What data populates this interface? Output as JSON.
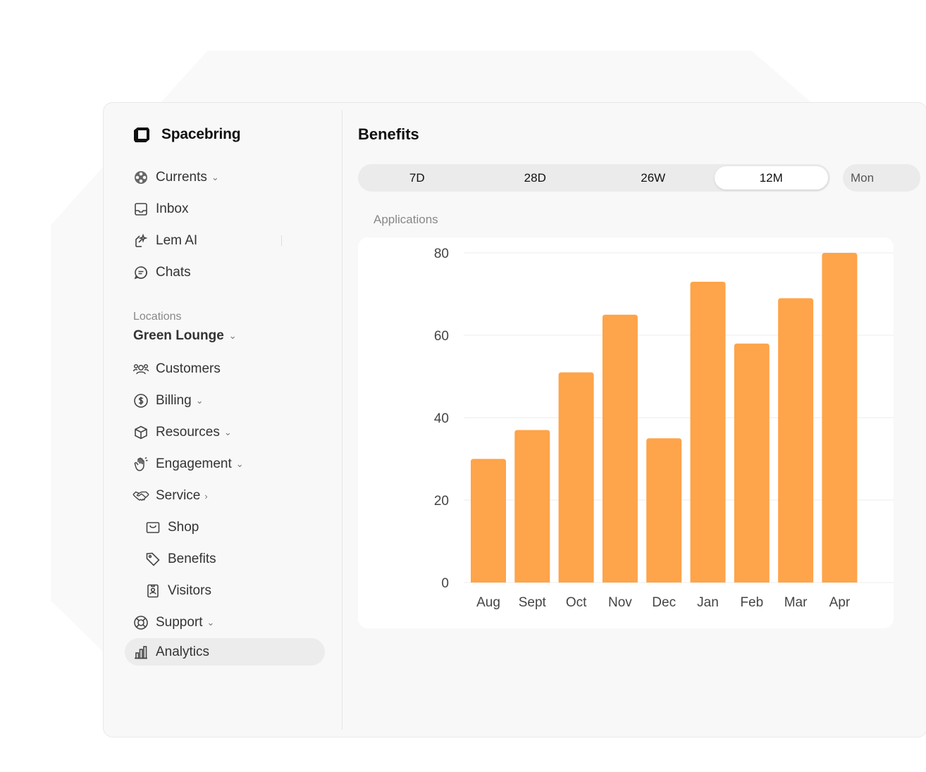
{
  "brand": {
    "name": "Spacebring"
  },
  "sidebar": {
    "top_items": [
      {
        "label": "Currents",
        "icon": "currents-icon",
        "has_chevron": true
      },
      {
        "label": "Inbox",
        "icon": "inbox-icon"
      },
      {
        "label": "Lem AI",
        "icon": "lem-ai-icon"
      },
      {
        "label": "Chats",
        "icon": "chat-bubble-icon"
      }
    ],
    "section_label": "Locations",
    "location": "Green Lounge",
    "items": [
      {
        "label": "Customers",
        "icon": "users-icon"
      },
      {
        "label": "Billing",
        "icon": "dollar-coin-icon"
      },
      {
        "label": "Resources",
        "icon": "cube-icon"
      },
      {
        "label": "Engagement",
        "icon": "hand-wave-icon"
      },
      {
        "label": "Service",
        "icon": "handshake-icon"
      },
      {
        "label": "Shop",
        "icon": "shop-icon"
      },
      {
        "label": "Benefits",
        "icon": "tag-icon"
      },
      {
        "label": "Visitors",
        "icon": "badge-icon"
      },
      {
        "label": "Support",
        "icon": "lifebuoy-icon"
      },
      {
        "label": "Analytics",
        "icon": "bar-chart-icon"
      }
    ]
  },
  "main": {
    "title": "Benefits",
    "ranges": [
      "7D",
      "28D",
      "26W",
      "12M"
    ],
    "active_range": "12M",
    "extra_button": "Mon",
    "chart_label": "Applications"
  },
  "colors": {
    "bar": "#fea44a",
    "active_item_bg": "#ececec"
  },
  "chart_data": {
    "type": "bar",
    "title": "Applications",
    "categories": [
      "Aug",
      "Sept",
      "Oct",
      "Nov",
      "Dec",
      "Jan",
      "Feb",
      "Mar",
      "Apr"
    ],
    "values": [
      30,
      37,
      51,
      65,
      35,
      73,
      58,
      69,
      80
    ],
    "ylim": [
      0,
      80
    ],
    "yticks": [
      0,
      20,
      40,
      60,
      80
    ],
    "grid": true
  }
}
